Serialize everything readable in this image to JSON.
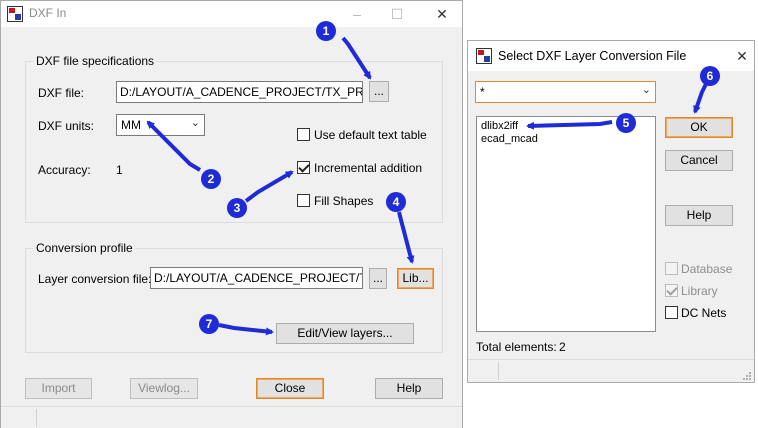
{
  "dxf_in": {
    "title": "DXF In",
    "spec_group_title": "DXF file specifications",
    "dxf_file_label": "DXF file:",
    "dxf_file_value": "D:/LAYOUT/A_CADENCE_PROJECT/TX_PROJE",
    "browse_label": "...",
    "dxf_units_label": "DXF units:",
    "dxf_units_value": "MM",
    "accuracy_label": "Accuracy:",
    "accuracy_value": "1",
    "use_default_text_table_label": "Use default text table",
    "use_default_text_table_checked": false,
    "incremental_addition_label": "Incremental addition",
    "incremental_addition_checked": true,
    "fill_shapes_label": "Fill Shapes",
    "fill_shapes_checked": false,
    "conversion_group_title": "Conversion profile",
    "layer_conversion_label": "Layer conversion file:",
    "layer_conversion_value": "D:/LAYOUT/A_CADENCE_PROJECT/TX_",
    "layer_browse_label": "...",
    "lib_label": "Lib...",
    "edit_view_label": "Edit/View layers...",
    "import_label": "Import",
    "viewlog_label": "Viewlog...",
    "close_label": "Close",
    "help_label": "Help"
  },
  "select_dialog": {
    "title": "Select DXF Layer Conversion File",
    "filter_value": "*",
    "files": [
      "dlibx2iff",
      "ecad_mcad"
    ],
    "ok_label": "OK",
    "cancel_label": "Cancel",
    "help_label": "Help",
    "database_label": "Database",
    "database_checked": false,
    "library_label": "Library",
    "library_checked": true,
    "dc_nets_label": "DC Nets",
    "dc_nets_checked": false,
    "total_label": "Total elements:",
    "total_value": "2"
  },
  "markers": [
    "1",
    "2",
    "3",
    "4",
    "5",
    "6",
    "7"
  ],
  "colors": {
    "marker": "#1f2bd6",
    "focus_border": "#e08a2a",
    "dialog_bg": "#f0f0f0"
  }
}
